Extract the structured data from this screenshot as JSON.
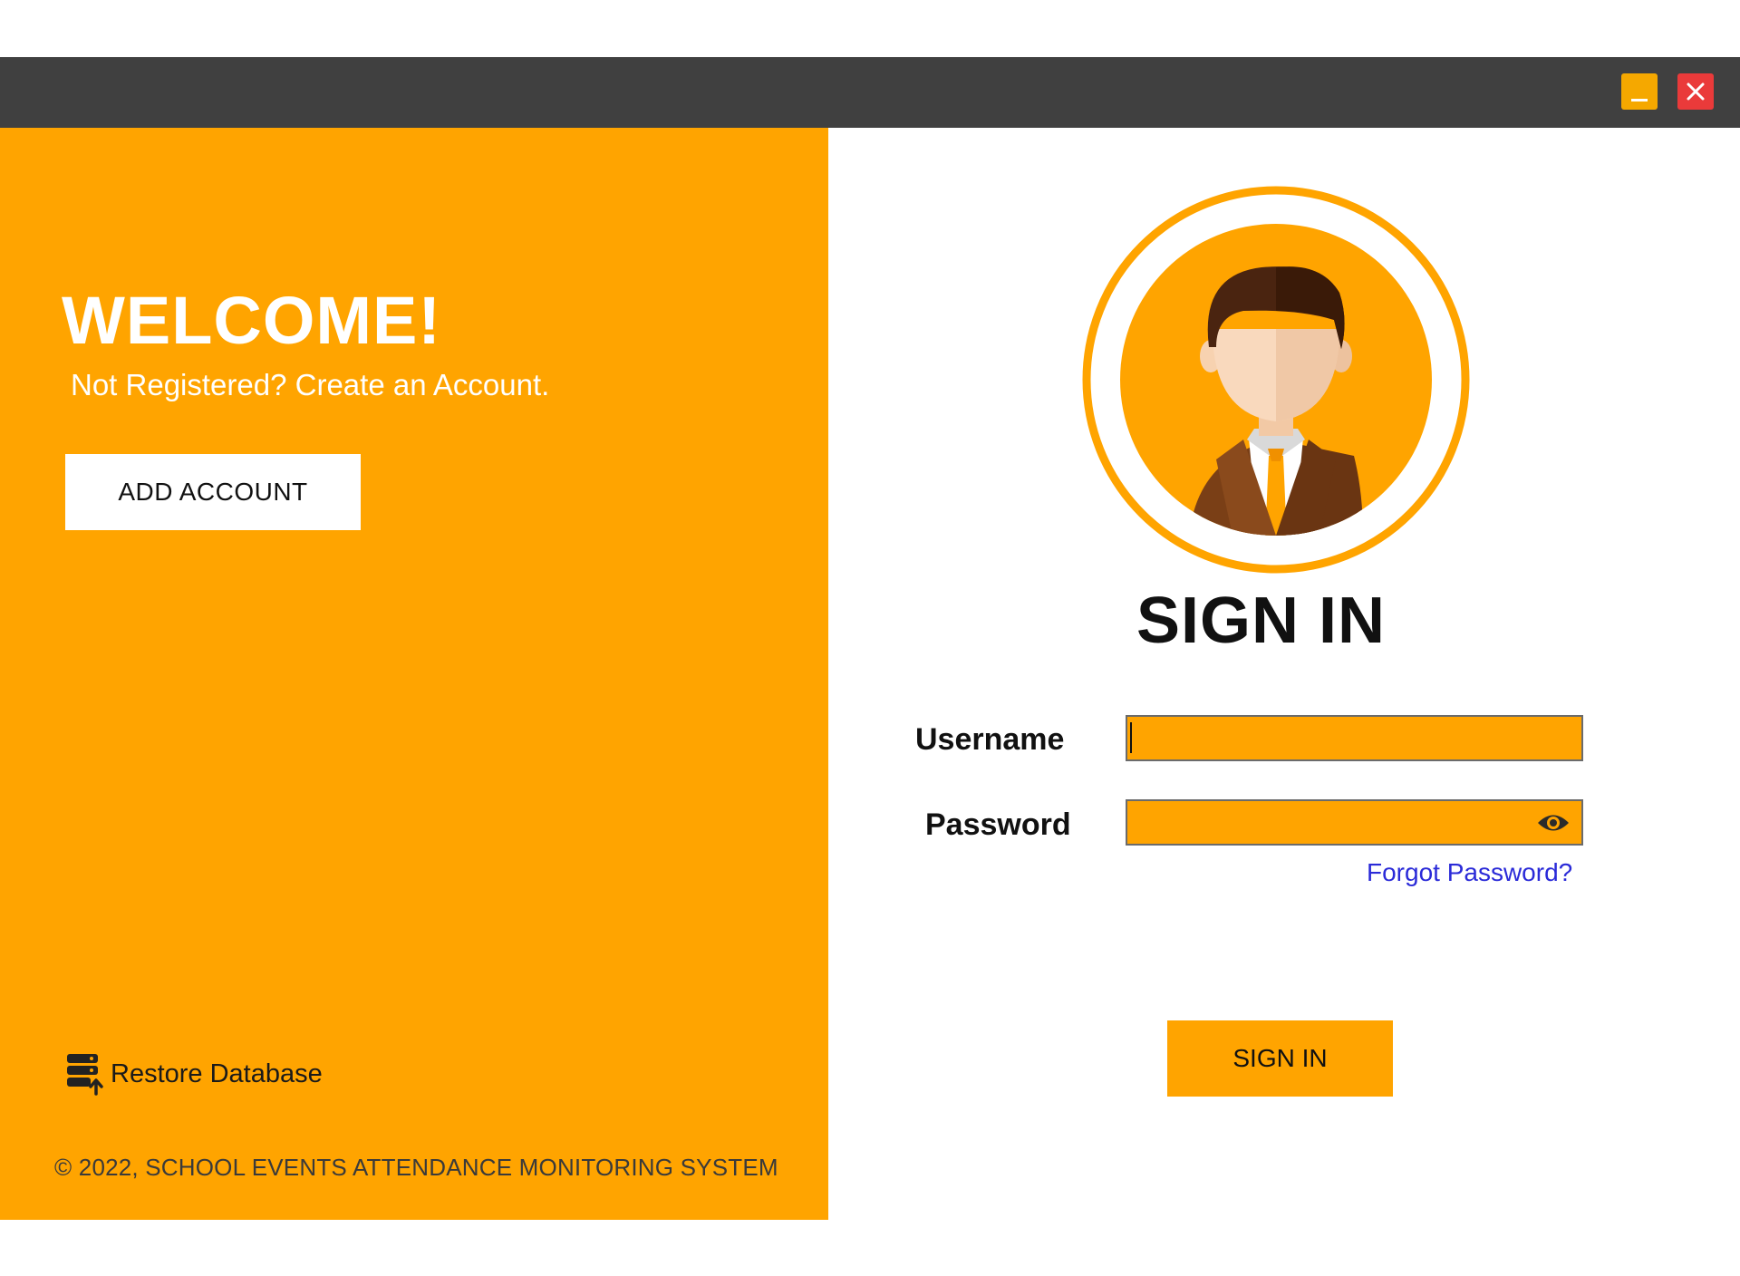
{
  "window": {
    "minimize_icon": "minimize-icon",
    "close_icon": "close-icon",
    "accent_color": "#ffa400",
    "titlebar_color": "#404040",
    "close_color": "#ea3a3a"
  },
  "left": {
    "welcome": "WELCOME!",
    "subtitle": "Not Registered? Create an Account.",
    "add_account_label": "ADD ACCOUNT",
    "restore_label": "Restore Database",
    "restore_icon": "database-upload-icon",
    "copyright": "© 2022, SCHOOL EVENTS ATTENDANCE MONITORING SYSTEM"
  },
  "right": {
    "avatar_icon": "user-avatar-icon",
    "title": "SIGN IN",
    "username_label": "Username",
    "username_value": "",
    "password_label": "Password",
    "password_value": "",
    "eye_icon": "show-password-eye-icon",
    "forgot_label": "Forgot Password?",
    "signin_button_label": "SIGN IN"
  }
}
